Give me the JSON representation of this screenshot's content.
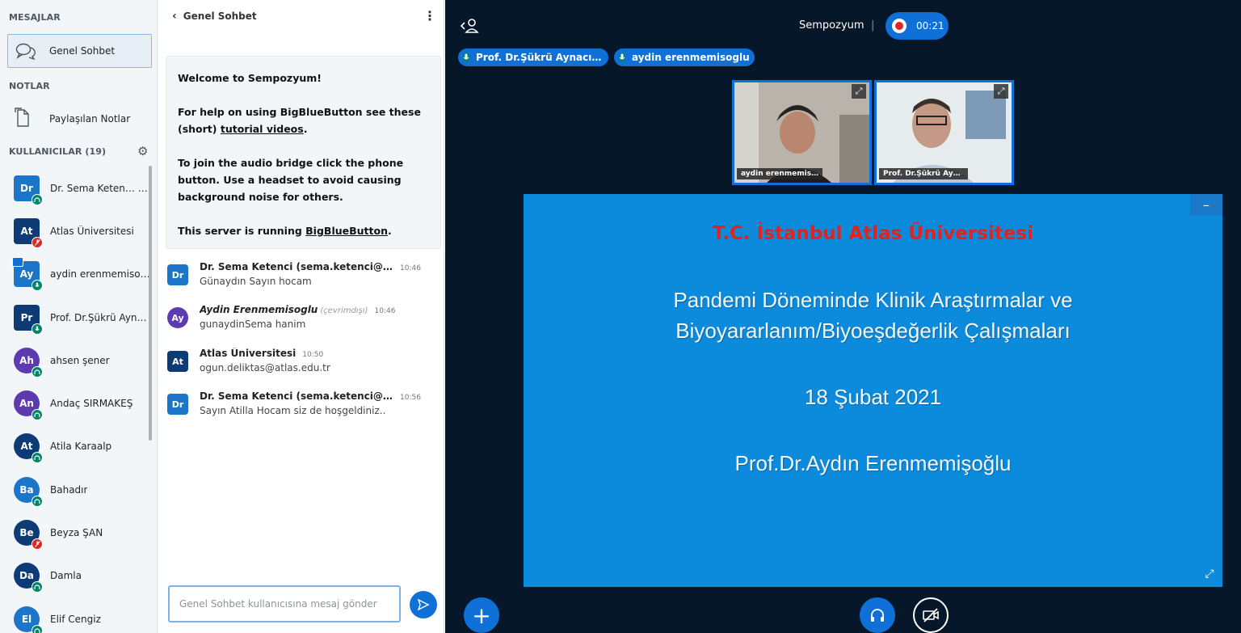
{
  "left": {
    "messages_title": "MESAJLAR",
    "chat_item": "Genel Sohbet",
    "notes_title": "NOTLAR",
    "notes_item": "Paylaşılan Notlar",
    "users_title": "KULLANICILAR (19)",
    "users": [
      {
        "initials": "Dr",
        "name": "Dr. Sema Keten…",
        "suffix": "(Siz)",
        "color": "#1b76c9",
        "badge": "headset",
        "shape": "square"
      },
      {
        "initials": "At",
        "name": "Atlas Üniversitesi",
        "color": "#0d3b75",
        "badge": "muted",
        "shape": "square"
      },
      {
        "initials": "Ay",
        "name": "aydin erenmemisog…",
        "color": "#1b76c9",
        "badge": "mic",
        "shape": "square",
        "presenter": true
      },
      {
        "initials": "Pr",
        "name": "Prof. Dr.Şükrü Ayna…",
        "color": "#0d3b75",
        "badge": "mic",
        "shape": "square"
      },
      {
        "initials": "Ah",
        "name": "ahsen şener",
        "color": "#5d3ab0",
        "badge": "headset",
        "shape": "round"
      },
      {
        "initials": "An",
        "name": "Andaç SIRMAKEŞ",
        "color": "#5d3ab0",
        "badge": "headset",
        "shape": "round"
      },
      {
        "initials": "At",
        "name": "Atila Karaalp",
        "color": "#0d3b75",
        "badge": "headset",
        "shape": "round"
      },
      {
        "initials": "Ba",
        "name": "Bahadır",
        "color": "#1b76c9",
        "badge": "headset",
        "shape": "round"
      },
      {
        "initials": "Be",
        "name": "Beyza ŞAN",
        "color": "#0d3b75",
        "badge": "muted",
        "shape": "round"
      },
      {
        "initials": "Da",
        "name": "Damla",
        "color": "#0d3b75",
        "badge": "headset",
        "shape": "round"
      },
      {
        "initials": "El",
        "name": "Elif Cengiz",
        "color": "#1b76c9",
        "badge": "headset",
        "shape": "round"
      }
    ]
  },
  "chat": {
    "header": "Genel Sohbet",
    "welcome_1a": "Welcome to ",
    "welcome_1b": "Sempozyum",
    "welcome_1c": "!",
    "welcome_2a": "For help on using BigBlueButton see these (short) ",
    "welcome_2b": "tutorial videos",
    "welcome_2c": ".",
    "welcome_3": "To join the audio bridge click the phone button. Use a headset to avoid causing background noise for others.",
    "welcome_4a": "This server is running ",
    "welcome_4b": "BigBlueButton",
    "welcome_4c": ".",
    "messages": [
      {
        "initials": "Dr",
        "color": "#1b76c9",
        "shape": "square",
        "sender": "Dr. Sema Ketenci (sema.ketenci@at…",
        "time": "10:46",
        "text": "Günaydın Sayın hocam"
      },
      {
        "initials": "Ay",
        "color": "#5d3ab0",
        "shape": "round",
        "sender": "Aydin Erenmemisoglu",
        "offline": "(çevrimdışı)",
        "time": "10:46",
        "text": "gunaydinSema hanim"
      },
      {
        "initials": "At",
        "color": "#0d3b75",
        "shape": "square",
        "sender": "Atlas Üniversitesi",
        "time": "10:50",
        "text": "ogun.deliktas@atlas.edu.tr"
      },
      {
        "initials": "Dr",
        "color": "#1b76c9",
        "shape": "square",
        "sender": "Dr. Sema Ketenci (sema.ketenci@at…",
        "time": "10:56",
        "text": "Sayın Atilla Hocam siz de hoşgeldiniz.."
      }
    ],
    "input_placeholder": "Genel Sohbet kullanıcısına mesaj gönder"
  },
  "main": {
    "meeting_title": "Sempozyum",
    "separator": "|",
    "rec_time": "00:21",
    "talkers": [
      "Prof. Dr.Şükrü Aynacı…",
      "aydin erenmemisoglu"
    ],
    "cams": [
      "aydin erenmemis…",
      "Prof. Dr.Şükrü Ayn…"
    ],
    "slide": {
      "title": "T.C. İstanbul Atlas Üniversitesi",
      "line1": "Pandemi Döneminde Klinik Araştırmalar ve",
      "line2": "Biyoyararlanım/Biyoeşdeğerlik Çalışmaları",
      "date": "18 Şubat 2021",
      "presenter": "Prof.Dr.Aydın Erenmemişoğlu"
    }
  },
  "colors": {
    "accent": "#0f70d7",
    "main_bg": "#06172a",
    "slide_bg": "#0c8bdd",
    "slide_title": "#e0231f"
  }
}
